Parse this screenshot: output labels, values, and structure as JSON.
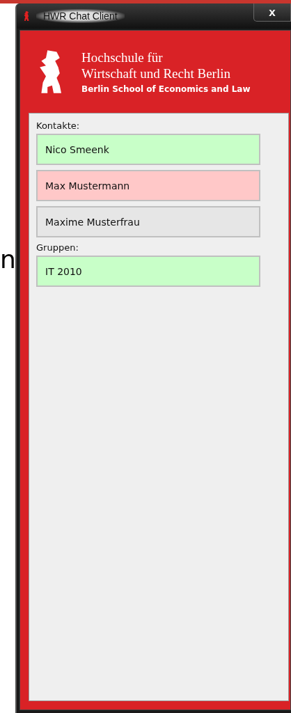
{
  "background": {
    "fragment": "n"
  },
  "window": {
    "title": "HWR Chat Client",
    "close": "x"
  },
  "header": {
    "line1": "Hochschule für",
    "line2": "Wirtschaft und Recht Berlin",
    "line3": "Berlin School of Economics and Law"
  },
  "sections": [
    {
      "label": "Kontakte:",
      "items": [
        {
          "name": "Nico Smeenk",
          "color": "#c8ffc8"
        },
        {
          "name": "Max Mustermann",
          "color": "#ffc8c8"
        },
        {
          "name": "Maxime Musterfrau",
          "color": "#e6e6e6"
        }
      ]
    },
    {
      "label": "Gruppen:",
      "items": [
        {
          "name": "IT 2010",
          "color": "#c8ffc8"
        }
      ]
    }
  ]
}
